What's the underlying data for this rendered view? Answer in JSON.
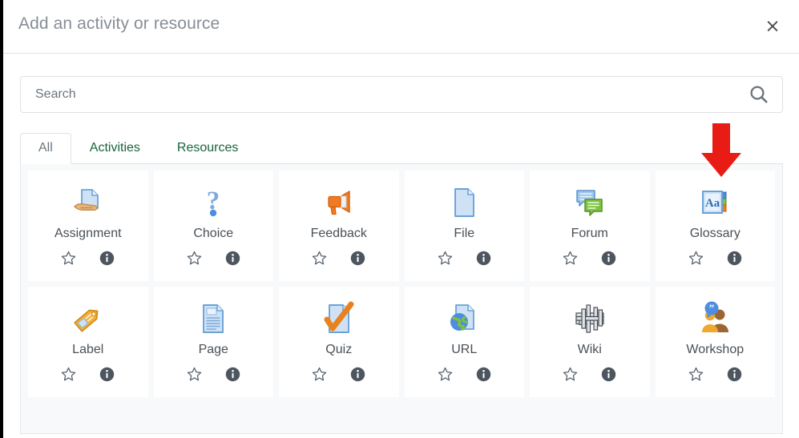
{
  "header": {
    "title": "Add an activity or resource",
    "close_label": "×"
  },
  "search": {
    "value": "",
    "placeholder": "Search",
    "icon": "search-icon"
  },
  "tabs": [
    {
      "label": "All",
      "active": true
    },
    {
      "label": "Activities",
      "active": false
    },
    {
      "label": "Resources",
      "active": false
    }
  ],
  "cards": [
    {
      "label": "Assignment",
      "icon": "assignment-icon",
      "star": "star-outline-icon",
      "info": "info-icon"
    },
    {
      "label": "Choice",
      "icon": "choice-icon",
      "star": "star-outline-icon",
      "info": "info-icon"
    },
    {
      "label": "Feedback",
      "icon": "feedback-icon",
      "star": "star-outline-icon",
      "info": "info-icon"
    },
    {
      "label": "File",
      "icon": "file-icon",
      "star": "star-outline-icon",
      "info": "info-icon"
    },
    {
      "label": "Forum",
      "icon": "forum-icon",
      "star": "star-outline-icon",
      "info": "info-icon"
    },
    {
      "label": "Glossary",
      "icon": "glossary-icon",
      "star": "star-outline-icon",
      "info": "info-icon"
    },
    {
      "label": "Label",
      "icon": "label-icon",
      "star": "star-outline-icon",
      "info": "info-icon"
    },
    {
      "label": "Page",
      "icon": "page-icon",
      "star": "star-outline-icon",
      "info": "info-icon"
    },
    {
      "label": "Quiz",
      "icon": "quiz-icon",
      "star": "star-outline-icon",
      "info": "info-icon"
    },
    {
      "label": "URL",
      "icon": "url-icon",
      "star": "star-outline-icon",
      "info": "info-icon"
    },
    {
      "label": "Wiki",
      "icon": "wiki-icon",
      "star": "star-outline-icon",
      "info": "info-icon"
    },
    {
      "label": "Workshop",
      "icon": "workshop-icon",
      "star": "star-outline-icon",
      "info": "info-icon"
    }
  ],
  "annotation": {
    "arrow": "red-down-arrow",
    "points_at": "Glossary",
    "color": "#e81c14"
  },
  "colors": {
    "title_text": "#868e96",
    "tab_link": "#18643a",
    "tab_active_text": "#6c757d",
    "panel_bg": "#f8f9fa",
    "card_bg": "#ffffff",
    "border": "#dee2e6",
    "icon_gray": "#5a6570"
  }
}
